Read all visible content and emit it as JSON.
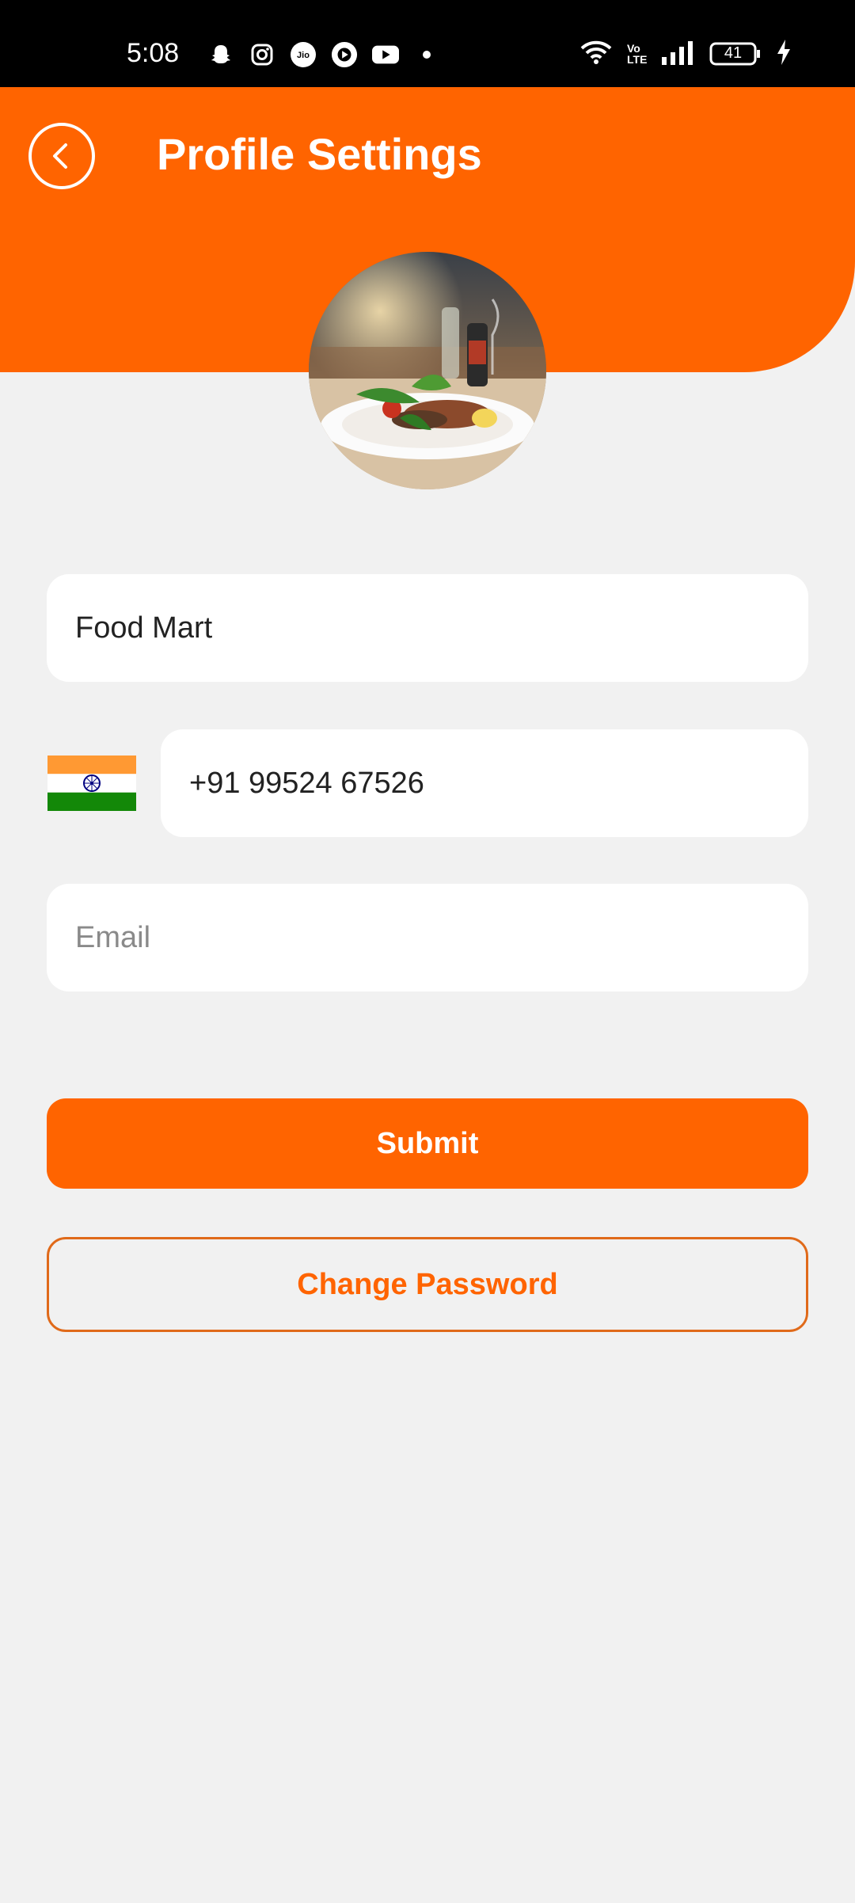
{
  "status_bar": {
    "time": "5:08",
    "icons_left": [
      "snapchat-icon",
      "instagram-icon",
      "jio-icon",
      "play-icon",
      "youtube-icon",
      "dot-icon"
    ],
    "icons_right": [
      "wifi-icon",
      "volte-icon",
      "signal-icon",
      "battery-icon",
      "charging-icon"
    ],
    "volte_label": "Vo LTE",
    "battery": "41"
  },
  "header": {
    "title": "Profile Settings",
    "bg_color": "#ff6400"
  },
  "form": {
    "name_value": "Food Mart",
    "phone_value": "+91 99524 67526",
    "email_placeholder": "Email",
    "email_value": ""
  },
  "buttons": {
    "submit_label": "Submit",
    "change_password_label": "Change Password"
  },
  "colors": {
    "accent": "#ff6400",
    "background": "#f1f1f1"
  }
}
